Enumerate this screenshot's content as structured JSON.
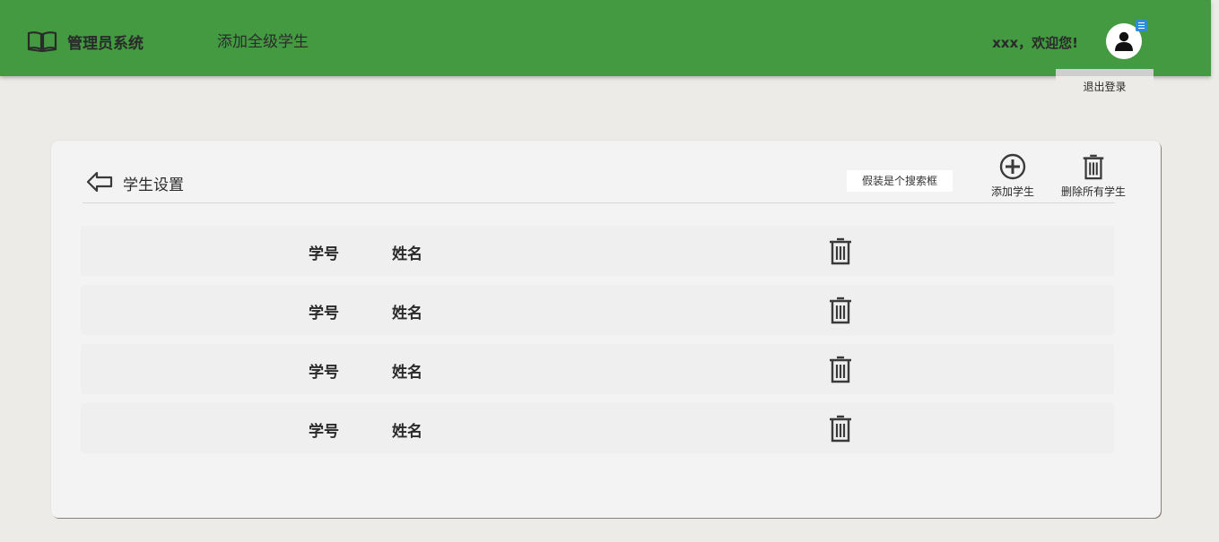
{
  "header": {
    "brand_title": "管理员系统",
    "nav_link": "添加全级学生",
    "welcome": "xxx，欢迎您!",
    "logout": "退出登录",
    "color": "#439a40"
  },
  "card": {
    "title": "学生设置",
    "search_placeholder": "假装是个搜索框",
    "add_label": "添加学生",
    "delete_all_label": "删除所有学生"
  },
  "students": [
    {
      "id": "学号",
      "name": "姓名"
    },
    {
      "id": "学号",
      "name": "姓名"
    },
    {
      "id": "学号",
      "name": "姓名"
    },
    {
      "id": "学号",
      "name": "姓名"
    }
  ],
  "icons": {
    "brand": "open-book-icon",
    "back": "back-arrow-icon",
    "add": "plus-circle-icon",
    "delete": "trash-icon",
    "avatar": "user-icon",
    "badge": "menu-icon"
  }
}
